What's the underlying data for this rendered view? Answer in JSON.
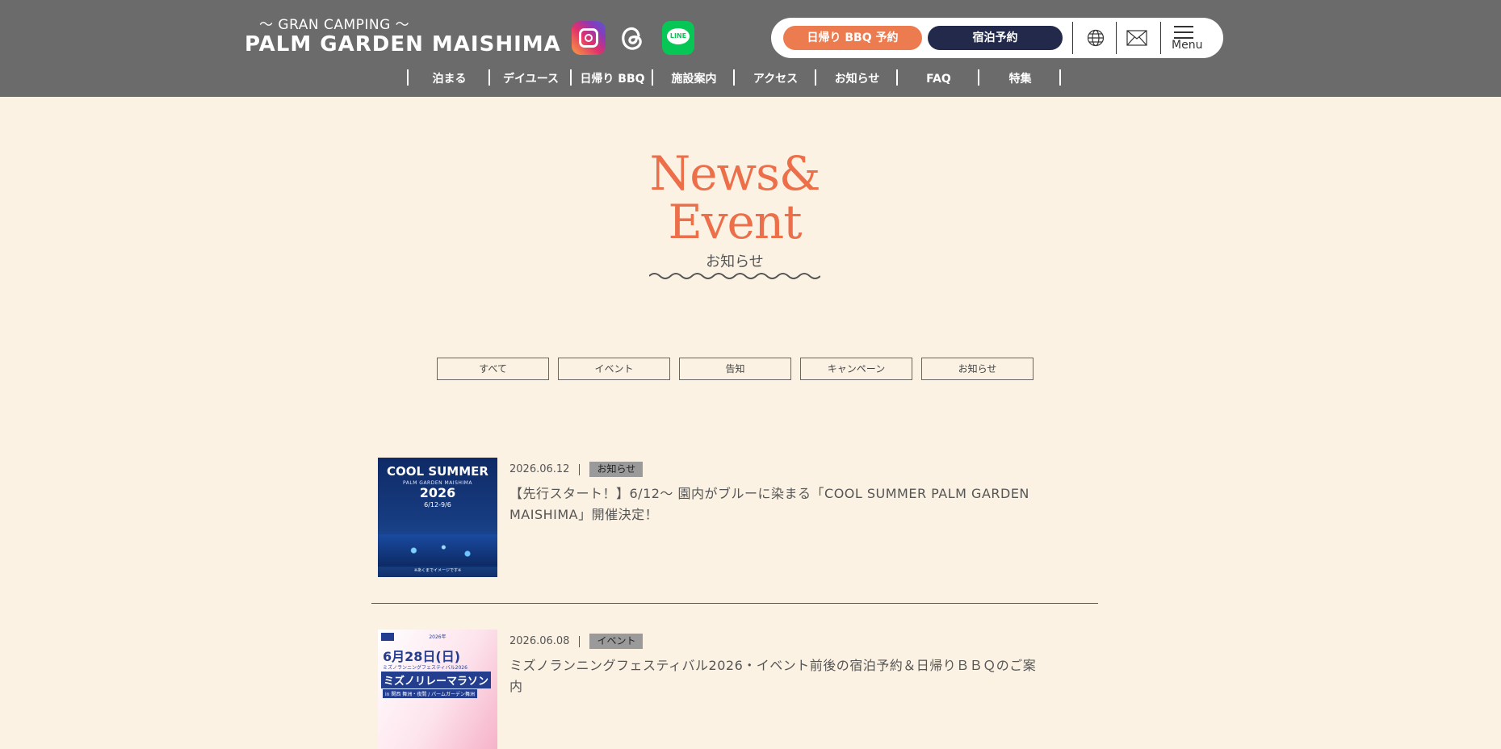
{
  "header": {
    "logo_sub": "〜 GRAN CAMPING 〜",
    "logo_main": "PALM GARDEN MAISHIMA",
    "social": [
      "instagram-icon",
      "threads-icon",
      "line-icon"
    ],
    "line_text": "LINE",
    "btn_bbq": "日帰り BBQ 予約",
    "btn_stay": "宿泊予約",
    "menu_label": "Menu",
    "colors": {
      "bbq": "#ec7c4f",
      "stay": "#22294a",
      "header_bg": "#6b6b6b"
    }
  },
  "nav": [
    {
      "label": "泊まる"
    },
    {
      "label": "デイユース"
    },
    {
      "label": "日帰り BBQ"
    },
    {
      "label": "施設案内"
    },
    {
      "label": "アクセス"
    },
    {
      "label": "お知らせ"
    },
    {
      "label": "FAQ"
    },
    {
      "label": "特集"
    }
  ],
  "hero": {
    "title_line1": "News&",
    "title_line2": "Event",
    "subtitle": "お知らせ",
    "accent": "#ec6f4a"
  },
  "filters": [
    "すべて",
    "イベント",
    "告知",
    "キャンペーン",
    "お知らせ"
  ],
  "news": [
    {
      "date": "2026.06.12",
      "tag": "お知らせ",
      "title": "【先行スタート！】6/12〜 園内がブルーに染まる「COOL SUMMER PALM GARDEN MAISHIMA」開催決定！",
      "thumb": {
        "line1": "COOL SUMMER",
        "line2": "PALM GARDEN MAISHIMA",
        "line3": "2026",
        "line4": "6/12-9/6",
        "note": "※あくまでイメージです※"
      }
    },
    {
      "date": "2026.06.08",
      "tag": "イベント",
      "title": "ミズノランニングフェスティバル2026・イベント前後の宿泊予約＆日帰りＢＢＱのご案内",
      "thumb": {
        "year": "2026年",
        "date": "6月28日(日)",
        "sub": "ミズノランニングフェスティバル2026",
        "main": "ミズノリレーマラソン",
        "loc": "in 関西 舞洲・夜間 / パームガーデン舞洲"
      }
    }
  ]
}
